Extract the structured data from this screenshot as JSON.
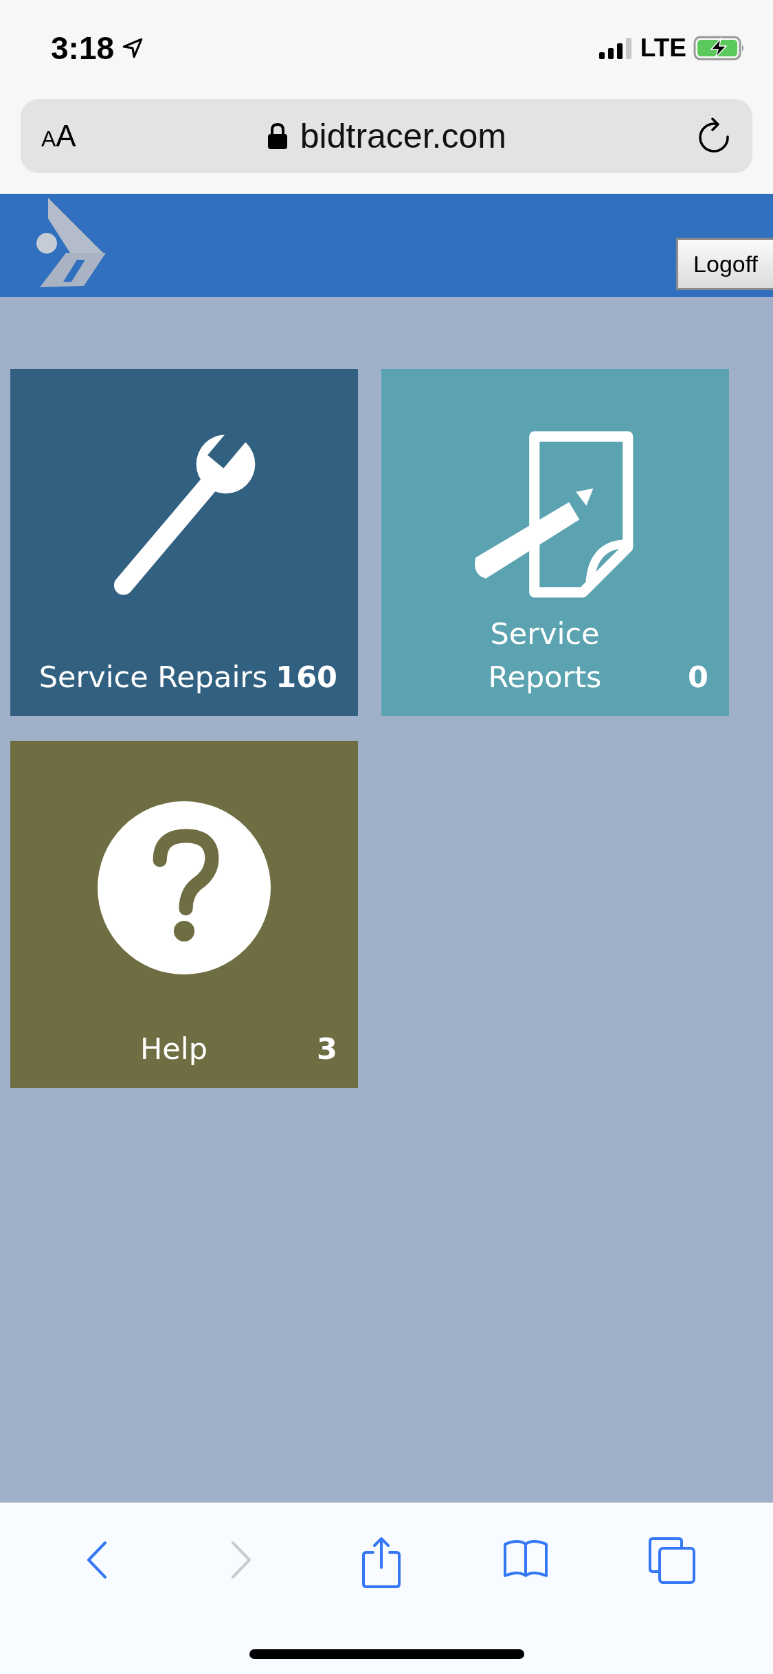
{
  "status_bar": {
    "time": "3:18",
    "network": "LTE"
  },
  "address_bar": {
    "text_size_button": {
      "small": "A",
      "large": "A"
    },
    "url": "bidtracer.com"
  },
  "header": {
    "logoff_button": "Logoff"
  },
  "tiles": [
    {
      "label": "Service Repairs",
      "count": "160",
      "kind": "wrench",
      "color": "#326081"
    },
    {
      "label": "Service\nReports",
      "count": "0",
      "kind": "report",
      "color": "#5ba3b0"
    },
    {
      "label": "Help",
      "count": "3",
      "kind": "help",
      "color": "#6f6d42"
    }
  ],
  "toolbar": [
    {
      "kind": "back",
      "disabled": false
    },
    {
      "kind": "forward",
      "disabled": true
    },
    {
      "kind": "share",
      "disabled": false
    },
    {
      "kind": "bookmarks",
      "disabled": false
    },
    {
      "kind": "tabs",
      "disabled": false
    }
  ]
}
